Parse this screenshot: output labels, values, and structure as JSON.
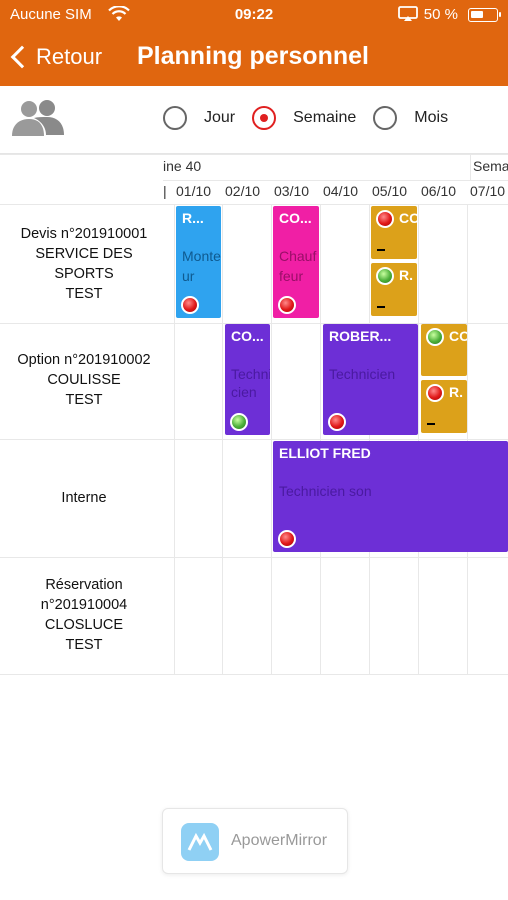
{
  "status_bar": {
    "carrier": "Aucune SIM",
    "time": "09:22",
    "battery": "50 %"
  },
  "nav": {
    "back_label": "Retour",
    "title": "Planning personnel"
  },
  "view_modes": {
    "options": [
      "Jour",
      "Semaine",
      "Mois"
    ],
    "selected": "Semaine"
  },
  "calendar": {
    "weeks": [
      "ine 40",
      "Sema"
    ],
    "days": [
      "01/10",
      "02/10",
      "03/10",
      "04/10",
      "05/10",
      "06/10",
      "07/10"
    ],
    "rows": [
      {
        "lines": [
          "Devis n°201910001",
          "SERVICE DES",
          "SPORTS",
          "TEST"
        ]
      },
      {
        "lines": [
          "Option n°201910002",
          "COULISSE",
          "TEST"
        ]
      },
      {
        "lines": [
          "Interne"
        ]
      },
      {
        "lines": [
          "Réservation",
          "n°201910004",
          "CLOSLUCE",
          "TEST"
        ]
      }
    ],
    "events": [
      {
        "title": "R...",
        "subtitle": "Monte",
        "subtitle2": "ur",
        "color": "#2fa3ef",
        "status": "red"
      },
      {
        "title": "CO...",
        "subtitle": "Chauf",
        "subtitle2": "feur",
        "color": "#f01fa5",
        "status": "red"
      },
      {
        "title": "CO",
        "color": "#dca11a",
        "status": "red"
      },
      {
        "title": "R.",
        "color": "#dca11a",
        "status": "green"
      },
      {
        "title": "CO...",
        "subtitle": "Techni",
        "subtitle2": "cien",
        "color": "#6d2fd6",
        "status": "green"
      },
      {
        "title": "ROBER...",
        "subtitle": "Technicien",
        "color": "#6d2fd6",
        "status": "red"
      },
      {
        "title": "CO",
        "color": "#dca11a",
        "status": "green"
      },
      {
        "title": "R.",
        "color": "#dca11a",
        "status": "red"
      },
      {
        "title": "ELLIOT FRED",
        "subtitle": "Technicien son",
        "color": "#6d2fd6",
        "status": "red"
      }
    ]
  },
  "watermark": {
    "text": "ApowerMirror"
  }
}
